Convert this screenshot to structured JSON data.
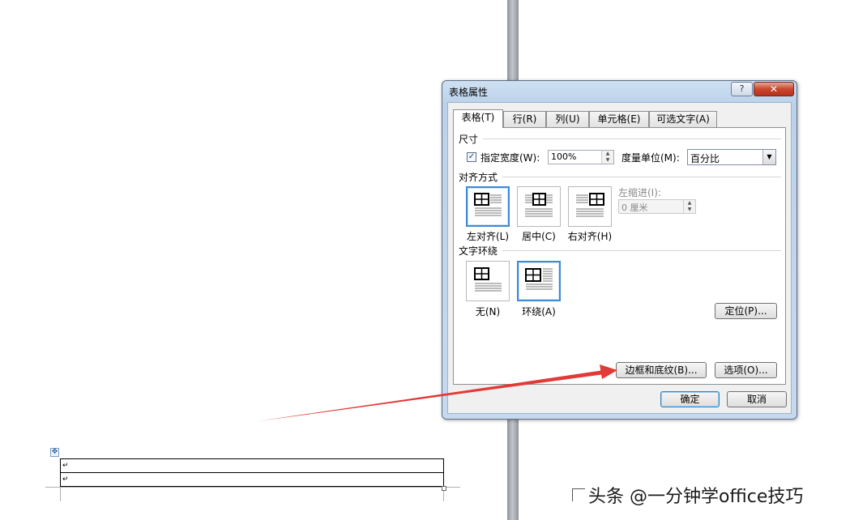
{
  "dialog": {
    "title": "表格属性",
    "help_label": "?",
    "close_label": "✕",
    "tabs": [
      {
        "label": "表格(T)"
      },
      {
        "label": "行(R)"
      },
      {
        "label": "列(U)"
      },
      {
        "label": "单元格(E)"
      },
      {
        "label": "可选文字(A)"
      }
    ],
    "size": {
      "section_label": "尺寸",
      "preferred_width_label": "指定宽度(W):",
      "preferred_width_checked": true,
      "width_value": "100%",
      "measure_label": "度量单位(M):",
      "measure_value": "百分比"
    },
    "alignment": {
      "section_label": "对齐方式",
      "options": [
        {
          "label": "左对齐(L)",
          "selected": true
        },
        {
          "label": "居中(C)",
          "selected": false
        },
        {
          "label": "右对齐(H)",
          "selected": false
        }
      ],
      "indent_label": "左缩进(I):",
      "indent_value": "0 厘米"
    },
    "wrapping": {
      "section_label": "文字环绕",
      "options": [
        {
          "label": "无(N)",
          "selected": false
        },
        {
          "label": "环绕(A)",
          "selected": true
        }
      ],
      "positioning_button": "定位(P)..."
    },
    "borders_button": "边框和底纹(B)...",
    "options_button": "选项(O)...",
    "ok_button": "确定",
    "cancel_button": "取消"
  },
  "document": {
    "table_cells": [
      "↵",
      "↵"
    ]
  },
  "watermark": "头条 @一分钟学office技巧",
  "colors": {
    "arrow": "#e23a36",
    "selected_border": "#3d8ad8",
    "close_button": "#c9452e"
  }
}
